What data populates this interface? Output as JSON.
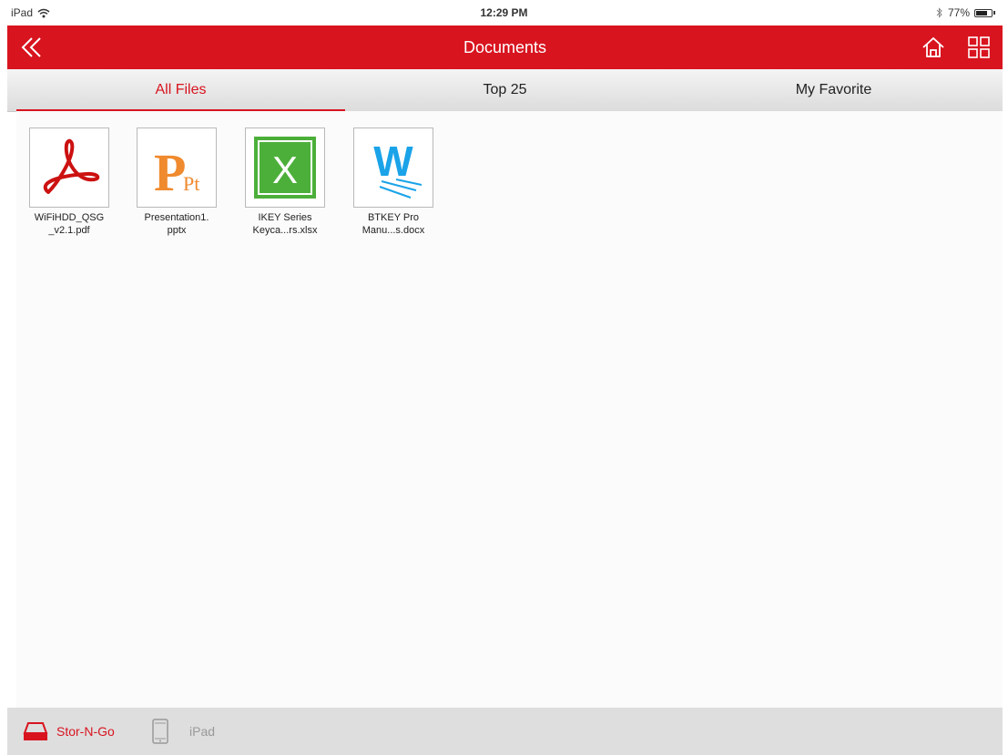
{
  "status_bar": {
    "device": "iPad",
    "time": "12:29 PM",
    "battery_percent_label": "77%",
    "battery_level": 0.77
  },
  "navbar": {
    "title": "Documents",
    "color": "#d8141f"
  },
  "tabs": [
    {
      "label": "All Files",
      "active": true
    },
    {
      "label": "Top 25",
      "active": false
    },
    {
      "label": "My Favorite",
      "active": false
    }
  ],
  "files": [
    {
      "name": "WiFiHDD_QSG\n_v2.1.pdf",
      "icon": "pdf-icon"
    },
    {
      "name": "Presentation1.\npptx",
      "icon": "pptx-icon"
    },
    {
      "name": "IKEY Series\nKeyca...rs.xlsx",
      "icon": "xlsx-icon"
    },
    {
      "name": "BTKEY Pro\nManu...s.docx",
      "icon": "docx-icon"
    }
  ],
  "bottom_bar": {
    "storngo_label": "Stor-N-Go",
    "ipad_label": "iPad"
  }
}
